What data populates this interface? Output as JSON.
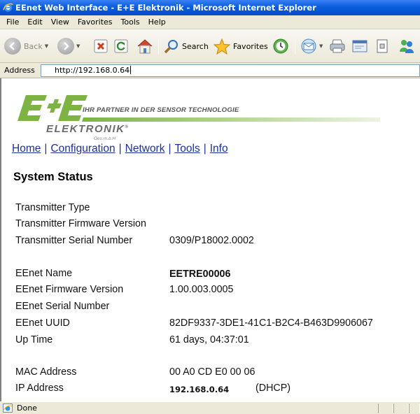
{
  "window": {
    "title": "EEnet Web Interface - E+E Elektronik - Microsoft Internet Explorer"
  },
  "menu": {
    "items": [
      "File",
      "Edit",
      "View",
      "Favorites",
      "Tools",
      "Help"
    ]
  },
  "toolbar": {
    "back_label": "Back",
    "search_label": "Search",
    "favorites_label": "Favorites",
    "icons": [
      "back-arrow-icon",
      "forward-arrow-icon",
      "stop-icon",
      "refresh-icon",
      "home-icon",
      "search-icon",
      "favorites-star-icon",
      "history-icon",
      "mail-icon",
      "print-icon",
      "edit-icon",
      "discuss-icon",
      "messenger-icon"
    ]
  },
  "address": {
    "label": "Address",
    "url": "http://192.168.0.64"
  },
  "page": {
    "logo": {
      "slogan": "IHR PARTNER IN DER SENSOR TECHNOLOGIE",
      "company": "ELEKTRONIK",
      "legal": "Ges.m.b.H",
      "mark_color": "#7cb342"
    },
    "nav": [
      "Home",
      "Configuration",
      "Network",
      "Tools",
      "Info"
    ],
    "heading": "System Status",
    "transmitter": {
      "type_label": "Transmitter Type",
      "type_value": "",
      "firmware_label": "Transmitter Firmware Version",
      "firmware_value": "",
      "serial_label": "Transmitter Serial Number",
      "serial_value": "0309/P18002.0002"
    },
    "eenet": {
      "name_label": "EEnet Name",
      "name_value": "EETRE00006",
      "firmware_label": "EEnet Firmware Version",
      "firmware_value": "1.00.003.0005",
      "serial_label": "EEnet Serial Number",
      "serial_value": "",
      "uuid_label": "EEnet UUID",
      "uuid_value": "82DF9337-3DE1-41C1-B2C4-B463D9906067",
      "uptime_label": "Up Time",
      "uptime_value": "61 days, 04:37:01"
    },
    "network": {
      "mac_label": "MAC Address",
      "mac_value": "00 A0 CD E0 00 06",
      "ip_label": "IP Address",
      "ip_value": "192.168.0.64",
      "ip_mode": "(DHCP)"
    }
  },
  "status": {
    "text": "Done"
  },
  "colors": {
    "titlebar": "#0a5ddc",
    "link": "#1d2f9e",
    "chrome": "#ece9d8"
  }
}
